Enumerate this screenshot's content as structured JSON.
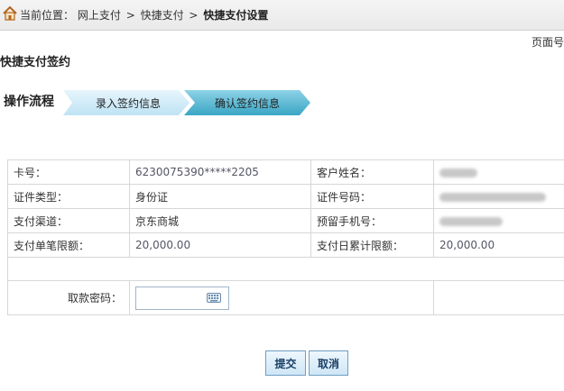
{
  "breadcrumb": {
    "prefix": "当前位置：",
    "items": [
      "网上支付",
      "快捷支付"
    ],
    "separator": ">",
    "current": "快捷支付设置"
  },
  "page_number_label": "页面号",
  "section_title": "快捷支付签约",
  "process": {
    "label": "操作流程",
    "steps": [
      "录入签约信息",
      "确认签约信息"
    ]
  },
  "info": {
    "rows": [
      {
        "label1": "卡号：",
        "value1": "6230075390*****2205",
        "label2": "客户姓名：",
        "value2": ""
      },
      {
        "label1": "证件类型：",
        "value1": "身份证",
        "label2": "证件号码：",
        "value2": ""
      },
      {
        "label1": "支付渠道：",
        "value1": "京东商城",
        "label2": "预留手机号：",
        "value2": ""
      },
      {
        "label1": "支付单笔限额：",
        "value1": "20,000.00",
        "label2": "支付日累计限额：",
        "value2": "20,000.00"
      }
    ],
    "password_label": "取款密码：",
    "password_value": ""
  },
  "buttons": {
    "submit": "提交",
    "cancel": "取消"
  },
  "colors": {
    "step_inactive": "#c9e9f7",
    "step_active": "#4fb5d1",
    "button_border": "#6f9ec4"
  }
}
